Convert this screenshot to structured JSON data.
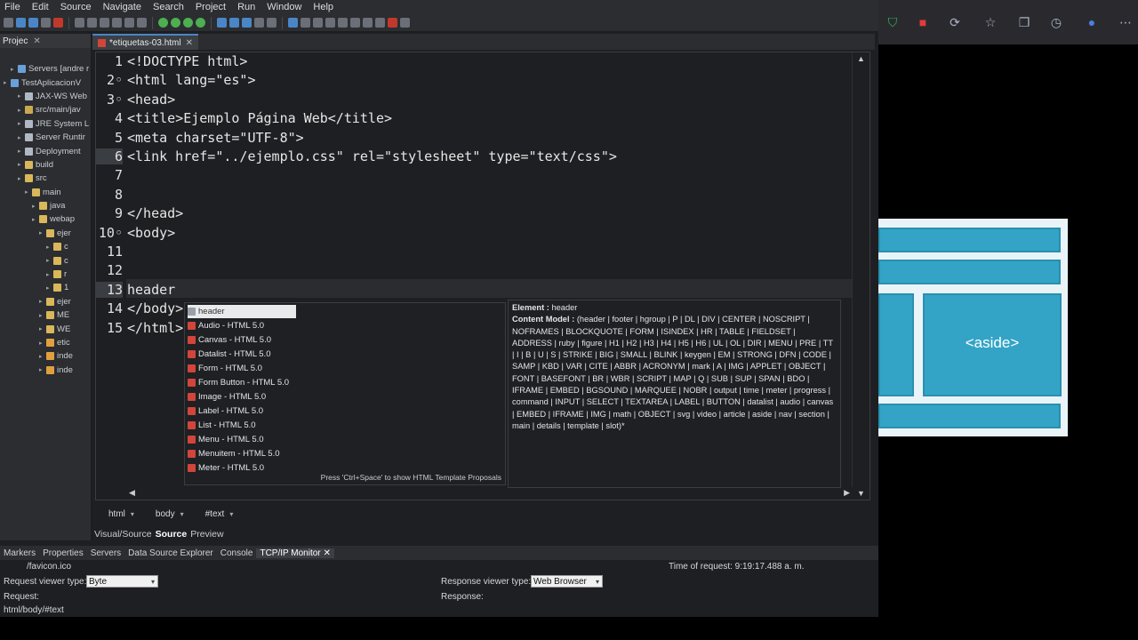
{
  "menu": [
    "File",
    "Edit",
    "Source",
    "Navigate",
    "Search",
    "Project",
    "Run",
    "Window",
    "Help"
  ],
  "explorer": {
    "tab_label": "Projec",
    "items": [
      {
        "label": "Servers [andre r",
        "indent": 1,
        "color": "#6aa0d8"
      },
      {
        "label": "TestAplicacionV",
        "indent": 0,
        "color": "#6aa0d8"
      },
      {
        "label": "JAX-WS Web",
        "indent": 2,
        "color": "#b0b8c4"
      },
      {
        "label": "src/main/jav",
        "indent": 2,
        "color": "#c9a94e"
      },
      {
        "label": "JRE System L",
        "indent": 2,
        "color": "#b0b8c4"
      },
      {
        "label": "Server Runtir",
        "indent": 2,
        "color": "#b0b8c4"
      },
      {
        "label": "Deployment",
        "indent": 2,
        "color": "#b0b8c4"
      },
      {
        "label": "build",
        "indent": 2,
        "color": "#d9b75a"
      },
      {
        "label": "src",
        "indent": 2,
        "color": "#d9b75a"
      },
      {
        "label": "main",
        "indent": 3,
        "color": "#d9b75a"
      },
      {
        "label": "java",
        "indent": 4,
        "color": "#d9b75a"
      },
      {
        "label": "webap",
        "indent": 4,
        "color": "#d9b75a"
      },
      {
        "label": "ejer",
        "indent": 5,
        "color": "#d9b75a"
      },
      {
        "label": "c",
        "indent": 6,
        "color": "#d9b75a"
      },
      {
        "label": "c",
        "indent": 6,
        "color": "#d9b75a"
      },
      {
        "label": "r",
        "indent": 6,
        "color": "#d9b75a"
      },
      {
        "label": "1",
        "indent": 6,
        "color": "#d9b75a"
      },
      {
        "label": "ejer",
        "indent": 5,
        "color": "#d9b75a"
      },
      {
        "label": "ME",
        "indent": 5,
        "color": "#d9b75a"
      },
      {
        "label": "WE",
        "indent": 5,
        "color": "#d9b75a"
      },
      {
        "label": "etic",
        "indent": 5,
        "color": "#e0a040"
      },
      {
        "label": "inde",
        "indent": 5,
        "color": "#e0a040"
      },
      {
        "label": "inde",
        "indent": 5,
        "color": "#e0a040"
      }
    ]
  },
  "editor": {
    "tab_label": "*etiquetas-03.html",
    "lines": [
      {
        "n": "1",
        "text": "<!DOCTYPE html>"
      },
      {
        "n": "2◦",
        "text": "<html lang=\"es\">"
      },
      {
        "n": "3◦",
        "text": "<head>"
      },
      {
        "n": "4",
        "text": "<title>Ejemplo Página Web</title>"
      },
      {
        "n": "5",
        "text": "<meta charset=\"UTF-8\">"
      },
      {
        "n": "6",
        "text": "<link href=\"../ejemplo.css\" rel=\"stylesheet\" type=\"text/css\">"
      },
      {
        "n": "7",
        "text": ""
      },
      {
        "n": "8",
        "text": ""
      },
      {
        "n": "9",
        "text": "</head>"
      },
      {
        "n": "10◦",
        "text": "<body>"
      },
      {
        "n": "11",
        "text": ""
      },
      {
        "n": "12",
        "text": ""
      },
      {
        "n": "13",
        "text": "header"
      },
      {
        "n": "14",
        "text": "</body>"
      },
      {
        "n": "15",
        "text": "</html>"
      }
    ]
  },
  "autocomplete": {
    "items": [
      "header",
      "Audio - HTML 5.0",
      "Canvas - HTML 5.0",
      "Datalist - HTML 5.0",
      "Form - HTML 5.0",
      "Form Button - HTML 5.0",
      "Image - HTML 5.0",
      "Label - HTML 5.0",
      "List - HTML 5.0",
      "Menu - HTML 5.0",
      "Menuitem - HTML 5.0",
      "Meter - HTML 5.0"
    ],
    "hint": "Press 'Ctrl+Space' to show HTML Template Proposals",
    "doc_element_label": "Element : ",
    "doc_element": "header",
    "doc_content_label": "Content Model : ",
    "doc_content": "(header | footer | hgroup | P | DL | DIV | CENTER | NOSCRIPT | NOFRAMES | BLOCKQUOTE | FORM | ISINDEX | HR | TABLE | FIELDSET | ADDRESS | ruby | figure | H1 | H2 | H3 | H4 | H5 | H6 | UL | OL | DIR | MENU | PRE | TT | I | B | U | S | STRIKE | BIG | SMALL | BLINK | keygen | EM | STRONG | DFN | CODE | SAMP | KBD | VAR | CITE | ABBR | ACRONYM | mark | A | IMG | APPLET | OBJECT | FONT | BASEFONT | BR | WBR | SCRIPT | MAP | Q | SUB | SUP | SPAN | BDO | IFRAME | EMBED | BGSOUND | MARQUEE | NOBR | output | time | meter | progress | command | INPUT | SELECT | TEXTAREA | LABEL | BUTTON | datalist | audio | canvas | EMBED | IFRAME | IMG | math | OBJECT | svg | video | article | aside | nav | section | main | details | template | slot)*"
  },
  "breadcrumb": [
    "html",
    "body",
    "#text"
  ],
  "source_tabs": [
    "Visual/Source",
    "Source",
    "Preview"
  ],
  "bottom_tabs": [
    "Markers",
    "Properties",
    "Servers",
    "Data Source Explorer",
    "Console",
    "TCP/IP Monitor"
  ],
  "tcp": {
    "favicon": "/favicon.ico",
    "time_of_request": "Time of request: 9:19:17.488 a. m.",
    "request_viewer_label": "Request viewer type:",
    "request_viewer_value": "Byte",
    "response_viewer_label": "Response viewer type:",
    "response_viewer_value": "Web Browser",
    "request_label": "Request:",
    "response_label": "Response:"
  },
  "status_path": "html/body/#text",
  "layout_image": {
    "aside_label": "<aside>"
  }
}
